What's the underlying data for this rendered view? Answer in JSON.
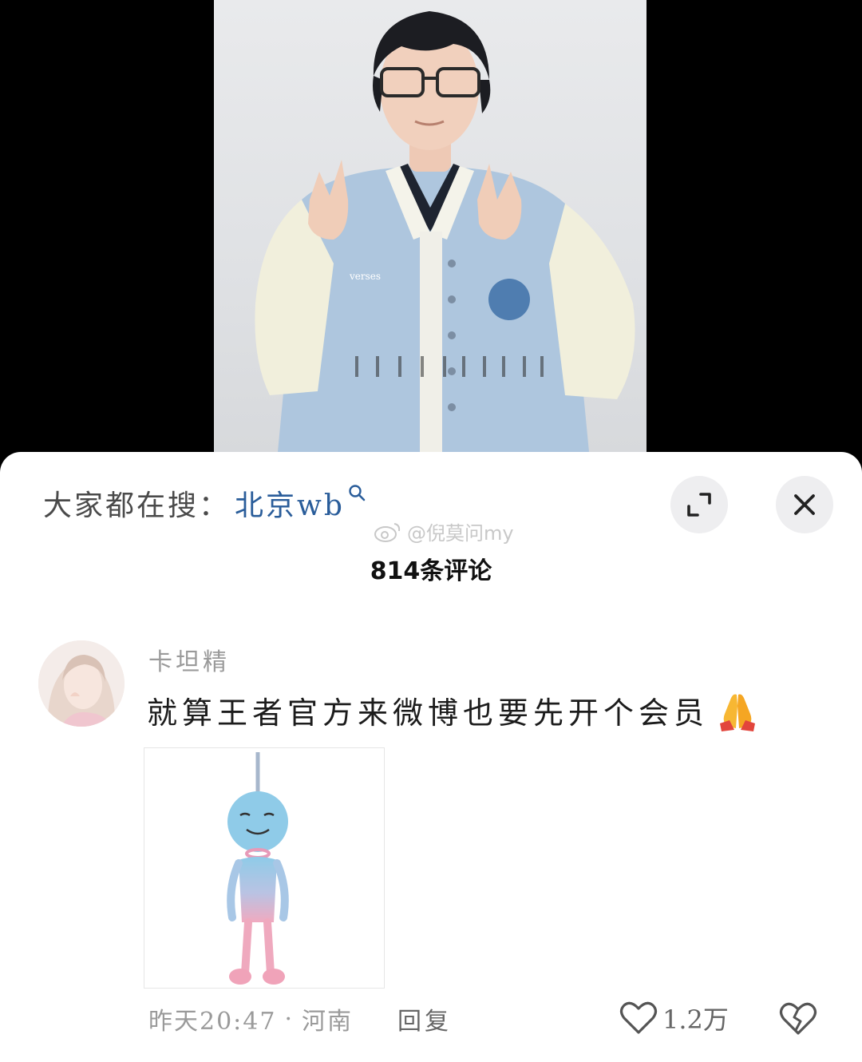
{
  "video": {
    "icon": "video-progress-dots"
  },
  "sheet": {
    "search_prefix": "大家都在搜：",
    "search_keyword": "北京wb",
    "search_icon": "search-icon",
    "expand_icon": "expand-icon",
    "close_icon": "close-icon",
    "watermark": "@倪莫问my",
    "comment_count": "814条评论"
  },
  "comment": {
    "username": "卡坦精",
    "text": "就算王者官方来微博也要先开个会员",
    "emoji": "praying-hands-icon",
    "time": "昨天20:47",
    "dot": "·",
    "location": "河南",
    "reply_label": "回复",
    "like_count": "1.2万"
  },
  "colors": {
    "keyword": "#2a5d9a",
    "muted": "#9a9a9a",
    "sheet_bg": "#ffffff",
    "button_bg": "#eeeef0"
  }
}
